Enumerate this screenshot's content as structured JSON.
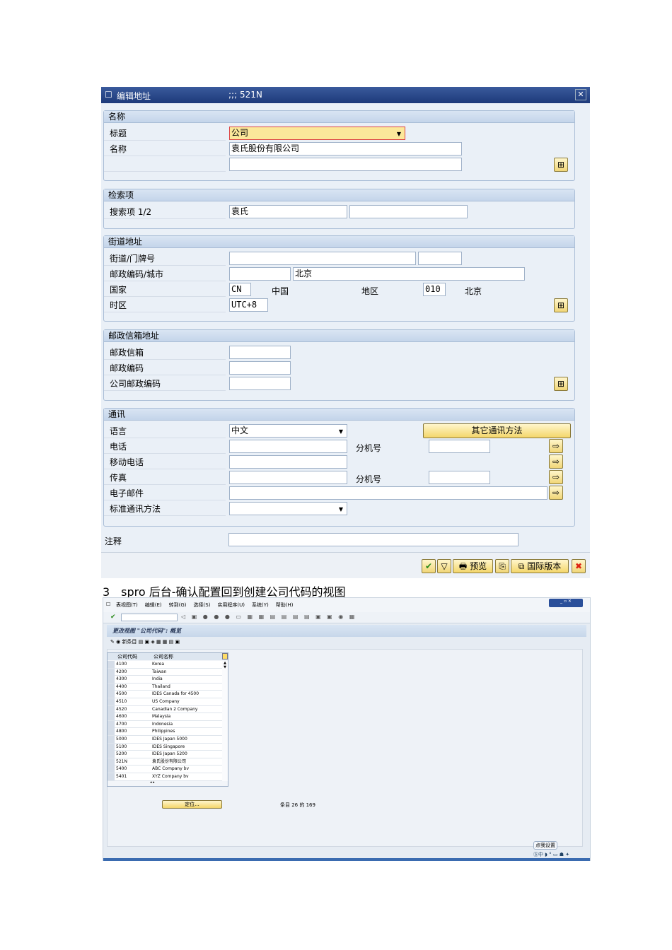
{
  "dialog": {
    "title": "编辑地址",
    "title_code": ";;; 521N",
    "sections": {
      "name": {
        "header": "名称",
        "title_label": "标题",
        "title_value": "公司",
        "name_label": "名称",
        "name_value": "袁氏股份有限公司",
        "name2_value": ""
      },
      "search": {
        "header": "检索项",
        "label": "搜索项 1/2",
        "value1": "袁氏",
        "value2": ""
      },
      "street": {
        "header": "街道地址",
        "street_label": "街道/门牌号",
        "postal_city_label": "邮政编码/城市",
        "city_value": "北京",
        "country_label": "国家",
        "country_code": "CN",
        "country_name": "中国",
        "region_label": "地区",
        "region_code": "010",
        "region_name": "北京",
        "tz_label": "时区",
        "tz_value": "UTC+8"
      },
      "pobox": {
        "header": "邮政信箱地址",
        "pobox_label": "邮政信箱",
        "postal_label": "邮政编码",
        "company_postal_label": "公司邮政编码"
      },
      "comm": {
        "header": "通讯",
        "lang_label": "语言",
        "lang_value": "中文",
        "other_btn": "其它通讯方法",
        "phone_label": "电话",
        "ext_label": "分机号",
        "mobile_label": "移动电话",
        "fax_label": "传真",
        "fax_ext_label": "分机号",
        "email_label": "电子邮件",
        "std_label": "标准通讯方法"
      }
    },
    "note_label": "注释",
    "toolbar": {
      "preview": "预览",
      "intl": "国际版本"
    }
  },
  "caption": "3　spro 后台-确认配置回到创建公司代码的视图",
  "sap2": {
    "menu": [
      "表视图(T)",
      "编辑(E)",
      "转到(G)",
      "选择(S)",
      "实用程序(U)",
      "系统(Y)",
      "帮助(H)"
    ],
    "screen_title": "更改视图 \"公司代码\": 概览",
    "new_entries": "新条目",
    "columns": [
      "公司代码",
      "公司名称"
    ],
    "rows": [
      [
        "4100",
        "Korea"
      ],
      [
        "4200",
        "Taiwan"
      ],
      [
        "4300",
        "India"
      ],
      [
        "4400",
        "Thailand"
      ],
      [
        "4500",
        "IDES Canada for 4500"
      ],
      [
        "4510",
        "US Company"
      ],
      [
        "4520",
        "Canadian 2 Company"
      ],
      [
        "4600",
        "Malaysia"
      ],
      [
        "4700",
        "Indonesia"
      ],
      [
        "4800",
        "Philippines"
      ],
      [
        "5000",
        "IDES Japan 5000"
      ],
      [
        "5100",
        "IDES Singapore"
      ],
      [
        "5200",
        "IDES Japan 5200"
      ],
      [
        "521N",
        "袁氏股份有限公司"
      ],
      [
        "5400",
        "ABC Company bv"
      ],
      [
        "5401",
        "XYZ Company bv"
      ]
    ],
    "position_btn": "定位...",
    "entry_count": "条目 26 的 169",
    "tooltip": "点我设置"
  }
}
